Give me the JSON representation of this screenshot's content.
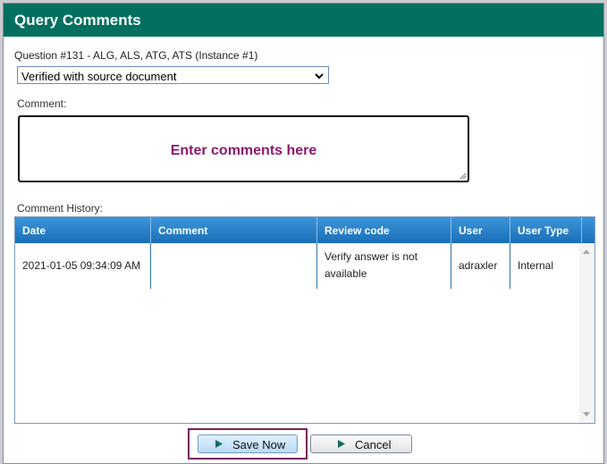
{
  "dialog": {
    "title": "Query Comments",
    "title_bar_color": "#03705f"
  },
  "question": {
    "label": "Question #131 - ALG, ALS, ATG, ATS (Instance #1)"
  },
  "review_select": {
    "selected": "Verified with source document"
  },
  "comment": {
    "label": "Comment:",
    "placeholder": "Enter comments here",
    "placeholder_color": "#8b1a6b"
  },
  "history": {
    "label": "Comment History:",
    "columns": [
      "Date",
      "Comment",
      "Review code",
      "User",
      "User Type"
    ],
    "rows": [
      {
        "date": "2021-01-05 09:34:09 AM",
        "comment": "",
        "review_code_line1": "Verify answer is not",
        "review_code_line2": "available",
        "user": "adraxler",
        "user_type": "Internal"
      }
    ]
  },
  "buttons": {
    "save": "Save Now",
    "cancel": "Cancel"
  },
  "icons": {
    "save": "play-arrow-icon",
    "cancel": "play-arrow-icon",
    "select": "chevron-down-icon"
  }
}
